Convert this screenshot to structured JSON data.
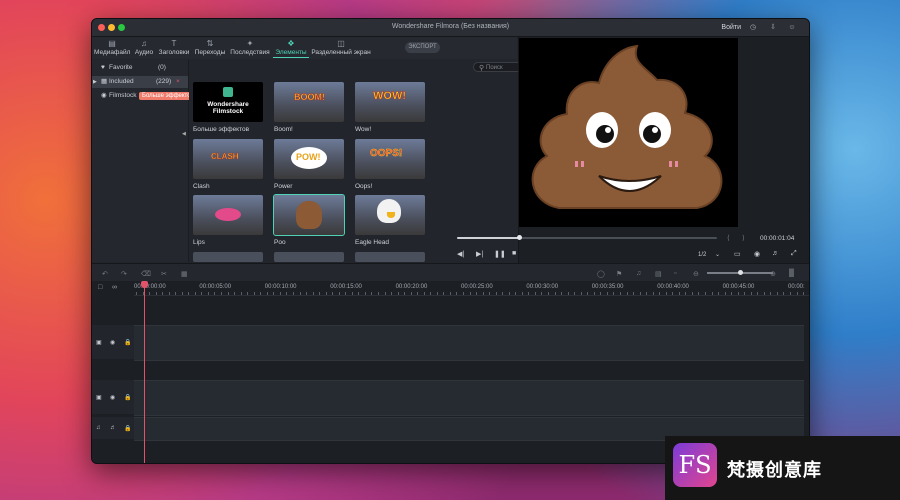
{
  "window": {
    "title": "Wondershare Filmora (Без названия)",
    "login_label": "Войти",
    "icons": [
      "support-icon",
      "download-icon",
      "account-icon"
    ]
  },
  "toolbar": {
    "tabs": [
      {
        "label": "Медиафайл",
        "icon": "folder-icon"
      },
      {
        "label": "Аудио",
        "icon": "music-icon"
      },
      {
        "label": "Заголовки",
        "icon": "text-icon"
      },
      {
        "label": "Переходы",
        "icon": "transition-icon"
      },
      {
        "label": "Последствия",
        "icon": "effects-icon"
      },
      {
        "label": "Элементы",
        "icon": "elements-icon",
        "active": true
      },
      {
        "label": "Разделенный экран",
        "icon": "split-screen-icon"
      }
    ],
    "export_label": "ЭКСПОРТ"
  },
  "sidebar": {
    "items": [
      {
        "label": "Favorite",
        "count": "(0)"
      },
      {
        "label": "Included",
        "count": "(229)",
        "selected": true
      },
      {
        "label": "Filmstock"
      }
    ],
    "tooltip": "Больше эффектов"
  },
  "browser": {
    "search_placeholder": "Поиск",
    "items": [
      {
        "label": "Больше эффектов",
        "thumb_title": "Wondershare Filmstock",
        "thumb": "filmstock"
      },
      {
        "label": "Boom!",
        "thumb_text": "BOOM!",
        "thumb": "comic"
      },
      {
        "label": "Wow!",
        "thumb_text": "WOW!",
        "thumb": "comic"
      },
      {
        "label": "Clash",
        "thumb_text": "CLASH",
        "thumb": "comic"
      },
      {
        "label": "Power",
        "thumb_text": "POW!",
        "thumb": "comic"
      },
      {
        "label": "Oops!",
        "thumb_text": "OOPS!",
        "thumb": "comic"
      },
      {
        "label": "Lips",
        "thumb": "lips"
      },
      {
        "label": "Poo",
        "thumb": "poo",
        "selected": true
      },
      {
        "label": "Eagle Head",
        "thumb": "eagle"
      }
    ]
  },
  "preview": {
    "timecode": "00:00:01:04",
    "progress": 0.24,
    "quality": "1/2"
  },
  "timeline": {
    "ruler": [
      "00:00:00:00",
      "00:00:05:00",
      "00:00:10:00",
      "00:00:15:00",
      "00:00:20:00",
      "00:00:25:00",
      "00:00:30:00",
      "00:00:35:00",
      "00:00:40:00",
      "00:00:45:00",
      "00:00:"
    ],
    "zoom": 0.5
  },
  "watermark": {
    "logo_text": "FS",
    "text": "梵摄创意库"
  }
}
